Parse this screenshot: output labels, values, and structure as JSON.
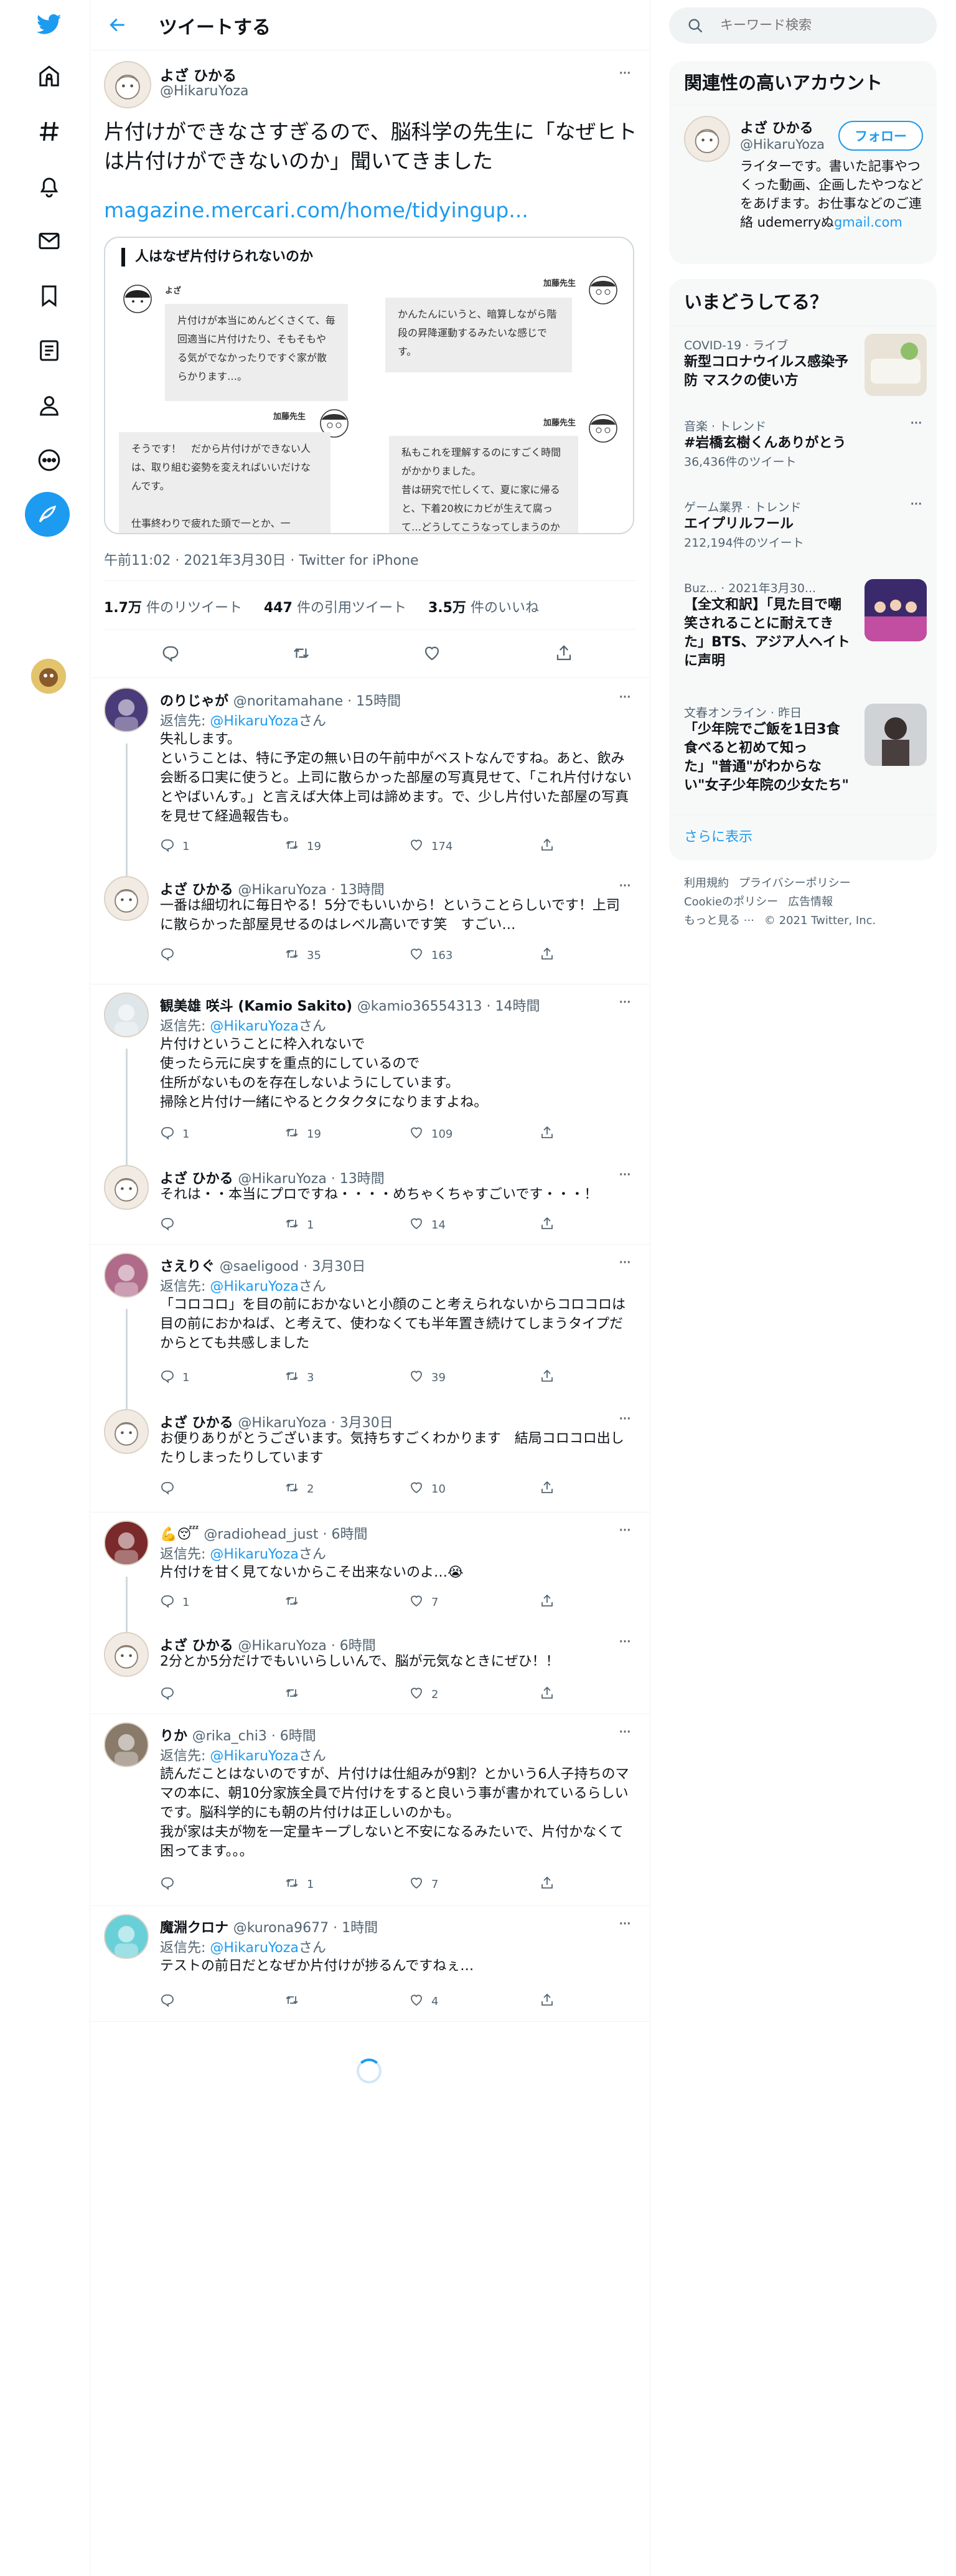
{
  "header": {
    "title": "ツイートする"
  },
  "search": {
    "placeholder": "キーワード検索"
  },
  "focus_tweet": {
    "name": "よざ ひかる",
    "handle": "@HikaruYoza",
    "text": "片付けができなさすぎるので、脳科学の先生に「なぜヒトは片付けができないのか」聞いてきました",
    "link": "magazine.mercari.com/home/tidyingup...",
    "card": {
      "title": "人はなぜ片付けられないのか",
      "speaker_a": "よざ",
      "speaker_b": "加藤先生",
      "bubble1": "片付けが本当にめんどくさくて、毎回適当に片付けたり、そもそもやる気がでなかったりですぐ家が散らかります…。",
      "bubble2": "かんたんにいうと、暗算しながら階段の昇降運動するみたいな感じです。",
      "bubble3": "そうです！　だから片付けができない人は、取り組む姿勢を変えればいいだけなんです。\n\n仕事終わりで疲れた頭で一とか、一",
      "bubble4": "私もこれを理解するのにすごく時間がかかりました。\n昔は研究で忙しくて、夏に家に帰ると、下着20枚にカビが生えて腐って…どうしてこうなってしまうのか"
    },
    "meta": "午前11:02 · 2021年3月30日 · Twitter for iPhone",
    "retweets": "1.7万",
    "retweets_label": "件のリツイート",
    "quotes": "447",
    "quotes_label": "件の引用ツイート",
    "likes": "3.5万",
    "likes_label": "件のいいね"
  },
  "replies": [
    {
      "name": "のりじゃが",
      "meta": "@noritamahane · 15時間",
      "replyto_prefix": "返信先: ",
      "replyto": "@HikaruYoza",
      "replyto_suffix": "さん",
      "text": "失礼します。\nということは、特に予定の無い日の午前中がベストなんですね。あと、飲み会断る口実に使うと。上司に散らかった部屋の写真見せて、「これ片付けないとやばいんす。」と言えば大体上司は諦めます。で、少し片付いた部屋の写真を見せて経過報告も。",
      "reply": "1",
      "rt": "19",
      "like": "174"
    },
    {
      "name": "よざ ひかる",
      "meta": "@HikaruYoza · 13時間",
      "text": "一番は細切れに毎日やる！5分でもいいから！ということらしいです！上司に散らかった部屋見せるのはレベル高いです笑　すごい…",
      "reply": "",
      "rt": "35",
      "like": "163"
    },
    {
      "name": "観美雄 咲斗 (Kamio Sakito)",
      "meta": "@kamio36554313 · 14時間",
      "replyto_prefix": "返信先: ",
      "replyto": "@HikaruYoza",
      "replyto_suffix": "さん",
      "text": "片付けということに枠入れないで\n使ったら元に戻すを重点的にしているので\n住所がないものを存在しないようにしています。\n掃除と片付け一緒にやるとクタクタになりますよね。",
      "reply": "1",
      "rt": "19",
      "like": "109"
    },
    {
      "name": "よざ ひかる",
      "meta": "@HikaruYoza · 13時間",
      "text": "それは・・本当にプロですね・・・・めちゃくちゃすごいです・・・！",
      "reply": "",
      "rt": "1",
      "like": "14"
    },
    {
      "name": "さえりぐ",
      "meta": "@saeligood · 3月30日",
      "replyto_prefix": "返信先: ",
      "replyto": "@HikaruYoza",
      "replyto_suffix": "さん",
      "text": "「コロコロ」を目の前におかないと小顔のこと考えられないからコロコロは目の前におかねば、と考えて、使わなくても半年置き続けてしまうタイプだからとても共感しました",
      "reply": "1",
      "rt": "3",
      "like": "39"
    },
    {
      "name": "よざ ひかる",
      "meta": "@HikaruYoza · 3月30日",
      "text": "お便りありがとうございます。気持ちすごくわかります　結局コロコロ出したりしまったりしています",
      "reply": "",
      "rt": "2",
      "like": "10"
    },
    {
      "name": "💪😴",
      "meta": "@radiohead_just · 6時間",
      "replyto_prefix": "返信先: ",
      "replyto": "@HikaruYoza",
      "replyto_suffix": "さん",
      "text": "片付けを甘く見てないからこそ出来ないのよ…😭",
      "reply": "1",
      "rt": "",
      "like": "7"
    },
    {
      "name": "よざ ひかる",
      "meta": "@HikaruYoza · 6時間",
      "text": "2分とか5分だけでもいいらしいんで、脳が元気なときにぜひ！！",
      "reply": "",
      "rt": "",
      "like": "2"
    },
    {
      "name": "りか",
      "meta": "@rika_chi3 · 6時間",
      "replyto_prefix": "返信先: ",
      "replyto": "@HikaruYoza",
      "replyto_suffix": "さん",
      "text": "読んだことはないのですが、片付けは仕組みが9割？とかいう6人子持ちのママの本に、朝10分家族全員で片付けをすると良いう事が書かれているらしいです。脳科学的にも朝の片付けは正しいのかも。\n我が家は夫が物を一定量キープしないと不安になるみたいで、片付かなくて困ってます。。。",
      "reply": "",
      "rt": "1",
      "like": "7"
    },
    {
      "name": "魔淵クロナ",
      "meta": "@kurona9677 · 1時間",
      "replyto_prefix": "返信先: ",
      "replyto": "@HikaruYoza",
      "replyto_suffix": "さん",
      "text": "テストの前日だとなぜか片付けが捗るんですねぇ…",
      "reply": "",
      "rt": "",
      "like": "4"
    }
  ],
  "relevant": {
    "title": "関連性の高いアカウント",
    "name": "よざ ひかる",
    "handle": "@HikaruYoza",
    "follow": "フォロー",
    "bio": "ライターです。書いた記事やつくった動画、企画したやつなどをあげます。お仕事などのご連絡 udemerry",
    "bio_link_prefix": "ぬ",
    "bio_link": "gmail.com"
  },
  "trends": {
    "title": "いまどうしてる？",
    "items": [
      {
        "meta": "COVID-19 · ライブ",
        "title": "新型コロナウイルス感染予防 マスクの使い方",
        "count": ""
      },
      {
        "meta": "音楽 · トレンド",
        "title": "#岩橋玄樹くんありがとう",
        "count": "36,436件のツイート"
      },
      {
        "meta": "ゲーム業界 · トレンド",
        "title": "エイプリルフール",
        "count": "212,194件のツイート"
      },
      {
        "meta": "Buz... · 2021年3月30...",
        "title": "【全文和訳】「見た目で嘲笑されることに耐えてきた」BTS、アジア人ヘイトに声明",
        "count": ""
      },
      {
        "meta": "文春オンライン · 昨日",
        "title": "「少年院でご飯を1日3食食べると初めて知った」\"普通\"がわからない\"女子少年院の少女たち\"",
        "count": ""
      }
    ],
    "more": "さらに表示"
  },
  "footer": {
    "links": [
      "利用規約",
      "プライバシーポリシー",
      "Cookieのポリシー",
      "広告情報",
      "もっと見る ···",
      "© 2021 Twitter, Inc."
    ]
  },
  "colors": {
    "accent": "#1d9bf0",
    "text": "#0f1419",
    "muted": "#536471"
  },
  "icons": [
    "twitter-logo-icon",
    "home-icon",
    "hashtag-icon",
    "bell-icon",
    "mail-icon",
    "bookmark-icon",
    "list-icon",
    "profile-icon",
    "more-circle-icon",
    "compose-icon",
    "back-arrow-icon",
    "search-icon",
    "reply-icon",
    "retweet-icon",
    "like-icon",
    "share-icon"
  ]
}
